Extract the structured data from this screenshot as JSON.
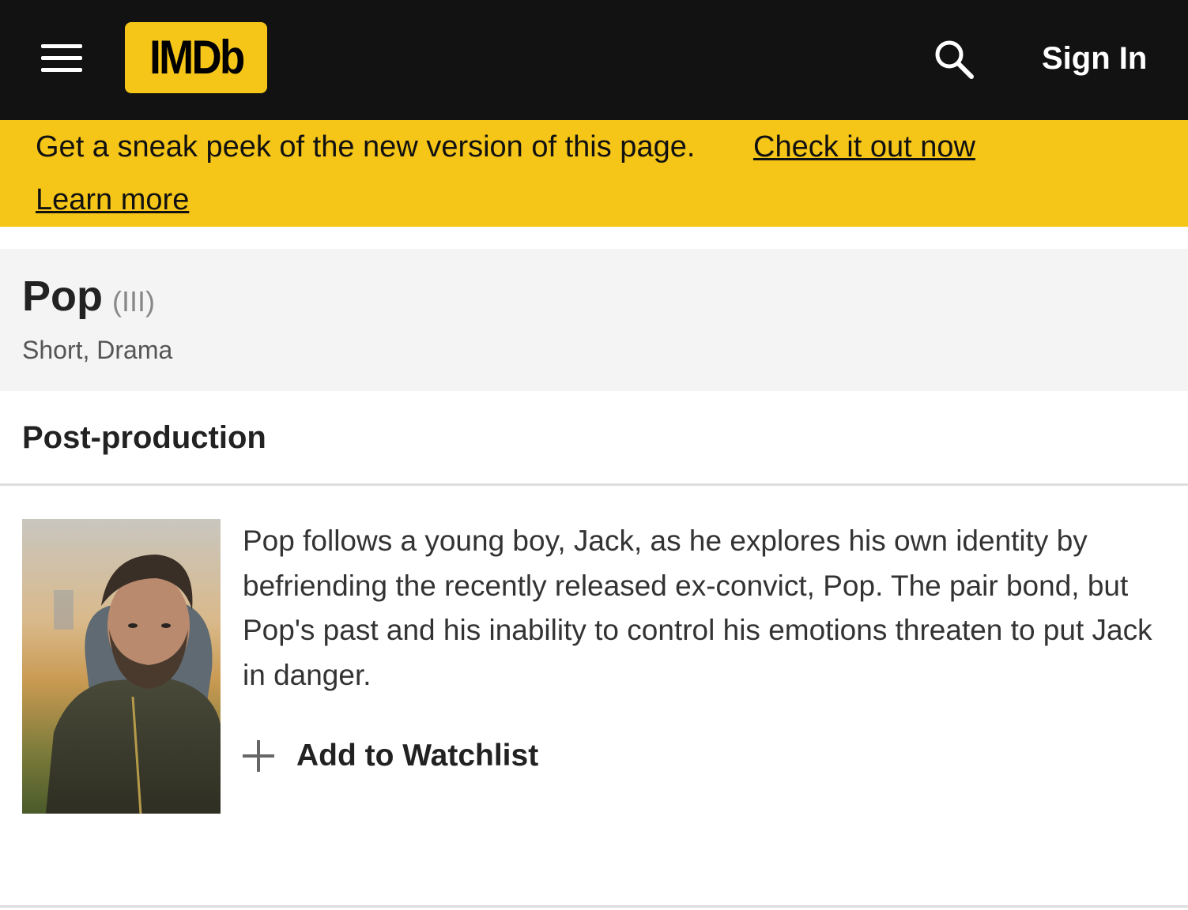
{
  "header": {
    "logo_text": "IMDb",
    "sign_in_label": "Sign In",
    "brand_color": "#f5c518",
    "bar_color": "#121212"
  },
  "promo": {
    "message": "Get a sneak peek of the new version of this page.",
    "check_link": "Check it out now",
    "learn_link": "Learn more"
  },
  "title": {
    "name": "Pop",
    "suffix": "(III)",
    "genres": "Short, Drama"
  },
  "status": "Post-production",
  "plot": "Pop follows a young boy, Jack, as he explores his own identity by befriending the recently released ex-convict, Pop. The pair bond, but Pop's past and his inability to control his emotions threaten to put Jack in danger.",
  "watchlist_label": "Add to Watchlist",
  "icons": {
    "menu": "hamburger-menu-icon",
    "search": "search-icon",
    "add": "plus-icon"
  }
}
